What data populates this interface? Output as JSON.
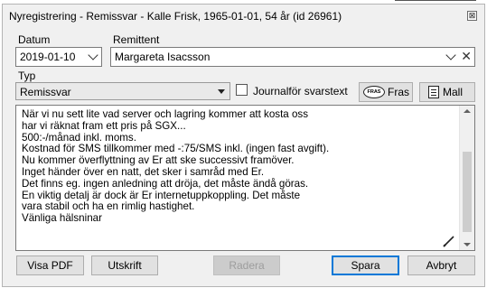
{
  "window": {
    "title": "Nyregistrering - Remissvar - Kalle Frisk, 1965-01-01, 54 år (id 26961)",
    "close_glyph": "⊠"
  },
  "fields": {
    "datum_label": "Datum",
    "datum_value": "2019-01-10",
    "remittent_label": "Remittent",
    "remittent_value": "Margareta Isacsson",
    "typ_label": "Typ",
    "typ_value": "Remissvar",
    "journal_label": "Journalför svarstext",
    "journal_checked": false
  },
  "toolbar": {
    "fras_label": "Fras",
    "fras_icon_text": "FRAS",
    "mall_label": "Mall"
  },
  "body_text": "När vi nu sett lite vad server och lagring kommer att kosta oss\nhar vi räknat fram ett pris på SGX...\n500:-/månad inkl. moms.\nKostnad för SMS tillkommer med -:75/SMS inkl. (ingen fast avgift).\nNu kommer överflyttning av Er att ske successivt framöver.\nInget händer över en natt, det sker i samråd med Er.\nDet finns eg. ingen anledning att dröja, det måste ändå göras.\nEn viktig detalj är dock är Er internetuppkoppling. Det måste\nvara stabil och ha en rimlig hastighet.\nVänliga hälsninar",
  "buttons": {
    "visa_pdf": "Visa PDF",
    "utskrift": "Utskrift",
    "radera": "Radera",
    "spara": "Spara",
    "avbryt": "Avbryt"
  },
  "colors": {
    "window_bg": "#f0f0f0",
    "focus_blue": "#0078d7"
  },
  "icons": {
    "close": "close-icon",
    "date_dropdown": "chevron-down-icon",
    "remittent_dropdown": "chevron-down-icon",
    "remittent_clear": "clear-icon",
    "typ_dropdown": "triangle-down-icon",
    "fras": "speech-bubble-icon",
    "mall": "document-icon",
    "edit": "pencil-icon"
  }
}
